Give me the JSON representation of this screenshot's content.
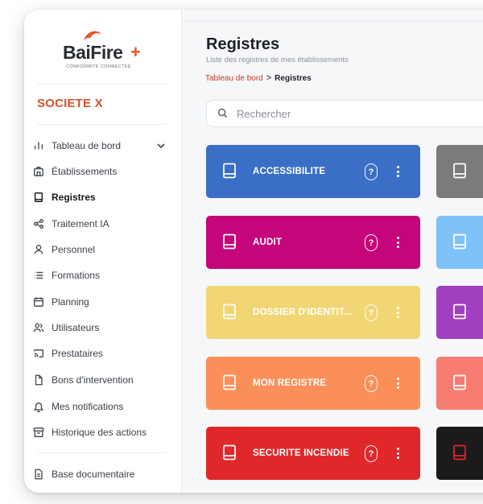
{
  "logo": {
    "brand": "BaiFire",
    "plus": "+",
    "tagline": "CONFORMITÉ CONNECTÉE"
  },
  "company": "SOCIETE X",
  "sidebar": {
    "items": [
      {
        "label": "Tableau de bord",
        "icon": "bar-chart-icon",
        "active": false,
        "has_chevron": true
      },
      {
        "label": "Établissements",
        "icon": "building-icon",
        "active": false
      },
      {
        "label": "Registres",
        "icon": "book-icon",
        "active": true
      },
      {
        "label": "Traitement IA",
        "icon": "share-nodes-icon",
        "active": false
      },
      {
        "label": "Personnel",
        "icon": "person-icon",
        "active": false
      },
      {
        "label": "Formations",
        "icon": "list-icon",
        "active": false
      },
      {
        "label": "Planning",
        "icon": "calendar-icon",
        "active": false
      },
      {
        "label": "Utilisateurs",
        "icon": "users-icon",
        "active": false
      },
      {
        "label": "Prestataires",
        "icon": "cast-icon",
        "active": false
      },
      {
        "label": "Bons d'intervention",
        "icon": "document-icon",
        "active": false
      },
      {
        "label": "Mes notifications",
        "icon": "bell-icon",
        "active": false
      },
      {
        "label": "Historique des actions",
        "icon": "archive-icon",
        "active": false
      },
      {
        "label": "Base documentaire",
        "icon": "file-text-icon",
        "active": false
      }
    ]
  },
  "main": {
    "title": "Registres",
    "subtitle": "Liste des registres de mes établissements",
    "breadcrumb": {
      "link": "Tableau de bord",
      "separator": ">",
      "current": "Registres"
    },
    "search": {
      "placeholder": "Rechercher",
      "value": ""
    }
  },
  "cards": [
    {
      "name": "ACCESSIBILITÉ",
      "color": "#3b6fc6",
      "help": "?"
    },
    {
      "name": "AUDIT",
      "color": "#c4067a",
      "help": "?"
    },
    {
      "name": "DOSSIER D'IDENTIT...",
      "color": "#f2d675",
      "help": "?"
    },
    {
      "name": "MON REGISTRE",
      "color": "#fb8f5a",
      "help": "?"
    },
    {
      "name": "SÉCURITÉ INCENDIE",
      "color": "#e0282a",
      "help": "?"
    }
  ],
  "cards_col2": [
    {
      "color": "#7b7b7b",
      "icon_color": "#ffffff"
    },
    {
      "color": "#7fc2f7",
      "icon_color": "#ffffff"
    },
    {
      "color": "#a23fc0",
      "icon_color": "#ffffff"
    },
    {
      "color": "#f77c72",
      "icon_color": "#ffffff"
    },
    {
      "color": "#1c1a1b",
      "icon_color": "#e0282a"
    }
  ]
}
